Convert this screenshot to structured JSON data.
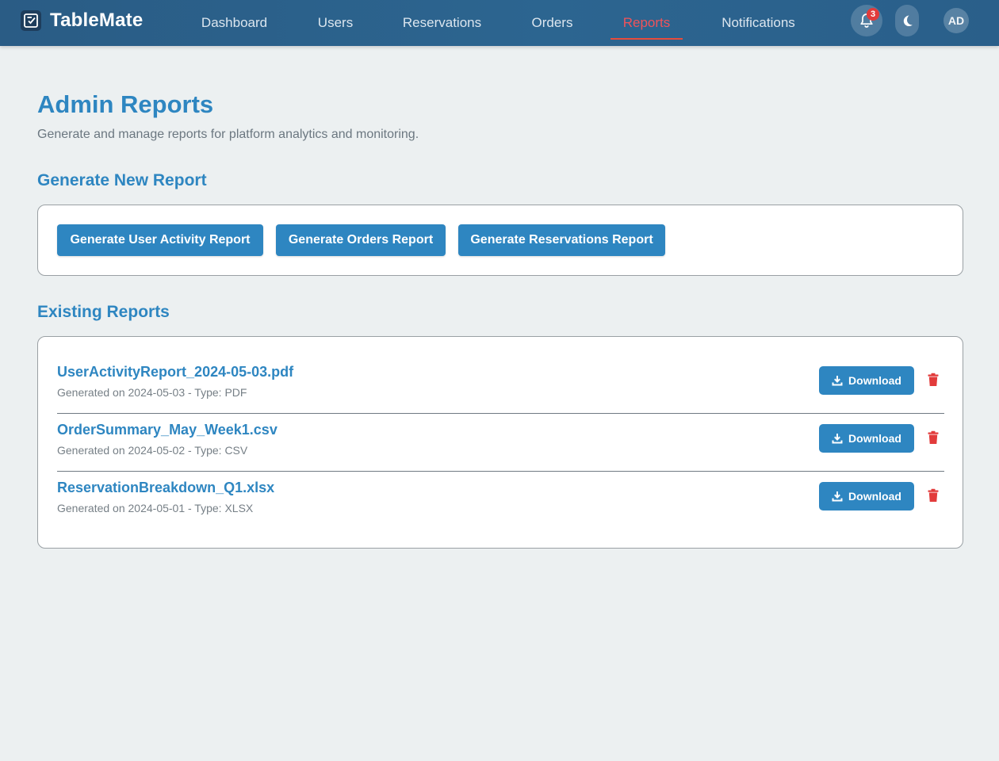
{
  "app": {
    "brand": "TableMate",
    "notification_count": "3",
    "avatar_initials": "AD",
    "colors": {
      "nav_bg": "#2c6590",
      "accent": "#2e86c1",
      "active_nav": "#e74c3c",
      "danger": "#e23b3b",
      "page_bg": "#ecf0f1"
    }
  },
  "nav": {
    "items": [
      {
        "label": "Dashboard",
        "active": false
      },
      {
        "label": "Users",
        "active": false
      },
      {
        "label": "Reservations",
        "active": false
      },
      {
        "label": "Orders",
        "active": false
      },
      {
        "label": "Reports",
        "active": true
      },
      {
        "label": "Notifications",
        "active": false
      }
    ],
    "icons": [
      "bell-icon",
      "moon-icon"
    ]
  },
  "page": {
    "title": "Admin Reports",
    "subtitle": "Generate and manage reports for platform analytics and monitoring."
  },
  "generate": {
    "heading": "Generate New Report",
    "buttons": [
      "Generate User Activity Report",
      "Generate Orders Report",
      "Generate Reservations Report"
    ]
  },
  "existing": {
    "heading": "Existing Reports",
    "download_label": "Download",
    "reports": [
      {
        "name": "UserActivityReport_2024-05-03.pdf",
        "meta": "Generated on 2024-05-03 - Type: PDF"
      },
      {
        "name": "OrderSummary_May_Week1.csv",
        "meta": "Generated on 2024-05-02 - Type: CSV"
      },
      {
        "name": "ReservationBreakdown_Q1.xlsx",
        "meta": "Generated on 2024-05-01 - Type: XLSX"
      }
    ]
  }
}
